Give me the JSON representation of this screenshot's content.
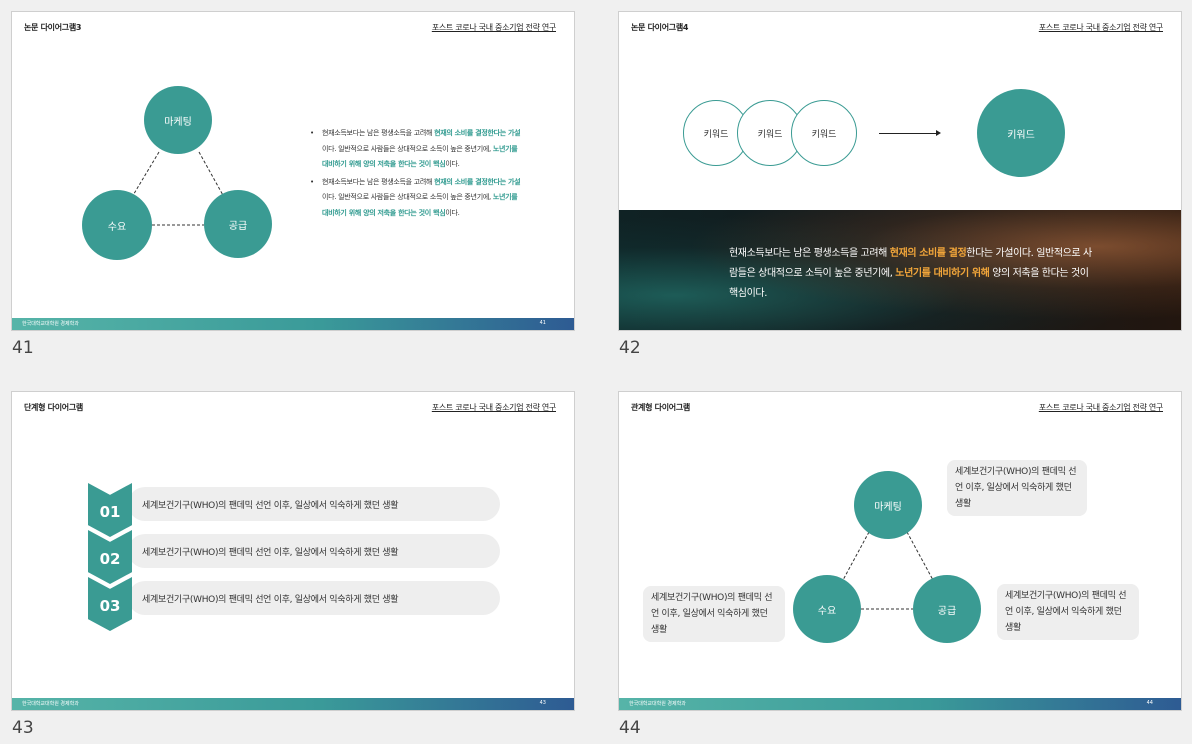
{
  "header_right": "포스트 코로나 국내 중소기업 전략 연구",
  "footer_org": "한국대학교대학원 경제학과",
  "slides": {
    "s41": {
      "title": "논문 다이어그램3",
      "number": "41",
      "page_label": "41",
      "circles": {
        "top": "마케팅",
        "left": "수요",
        "right": "공급"
      },
      "bullet1": {
        "a": "현재소득보다는 남은 평생소득을 고려해 ",
        "b": "현재의 소비를 결정한다는 가설",
        "c": "이다. 일반적으로 사람들은 상대적으로 소득이 높은 중년기에, ",
        "d": "노년기를 대비하기 위해 양의 저축을 한다는 것이 핵심",
        "e": "이다."
      },
      "bullet2": {
        "a": "현재소득보다는 남은 평생소득을 고려해 ",
        "b": "현재의 소비를 결정한다는 가설",
        "c": "이다. 일반적으로 사람들은 상대적으로 소득이 높은 중년기에, ",
        "d": "노년기를 대비하기 위해 양의 저축을 한다는 것이 핵심",
        "e": "이다."
      }
    },
    "s42": {
      "title": "논문 다이어그램4",
      "number": "42",
      "keywords": [
        "키워드",
        "키워드",
        "키워드"
      ],
      "big_keyword": "키워드",
      "text": {
        "a": "현재소득보다는 남은 평생소득을 고려해 ",
        "b": "현재의 소비를 결정",
        "c": "한다는 가설이다. 일반적으로 사람들은 상대적으로 소득이 높은 중년기에, ",
        "d": "노년기를 대비하기 위해",
        "e": " 양의 저축을 한다는 것이 핵심이다."
      }
    },
    "s43": {
      "title": "단계형 다이어그램",
      "number": "43",
      "page_label": "43",
      "steps": [
        {
          "num": "01",
          "text": "세계보건기구(WHO)의 팬데믹 선언 이후,  일상에서 익숙하게 했던 생활"
        },
        {
          "num": "02",
          "text": "세계보건기구(WHO)의 팬데믹 선언 이후,  일상에서 익숙하게 했던 생활"
        },
        {
          "num": "03",
          "text": "세계보건기구(WHO)의 팬데믹 선언 이후,  일상에서 익숙하게 했던 생활"
        }
      ]
    },
    "s44": {
      "title": "관계형 다이어그램",
      "number": "44",
      "page_label": "44",
      "circles": {
        "top": "마케팅",
        "left": "수요",
        "right": "공급"
      },
      "callouts": {
        "top": "세계보건기구(WHO)의 팬데믹 선언 이후,  일상에서 익숙하게 했던 생활",
        "left": "세계보건기구(WHO)의 팬데믹 선언 이후,  일상에서 익숙하게 했던 생활",
        "right": "세계보건기구(WHO)의 팬데믹 선언 이후,  일상에서 익숙하게 했던 생활"
      }
    }
  }
}
